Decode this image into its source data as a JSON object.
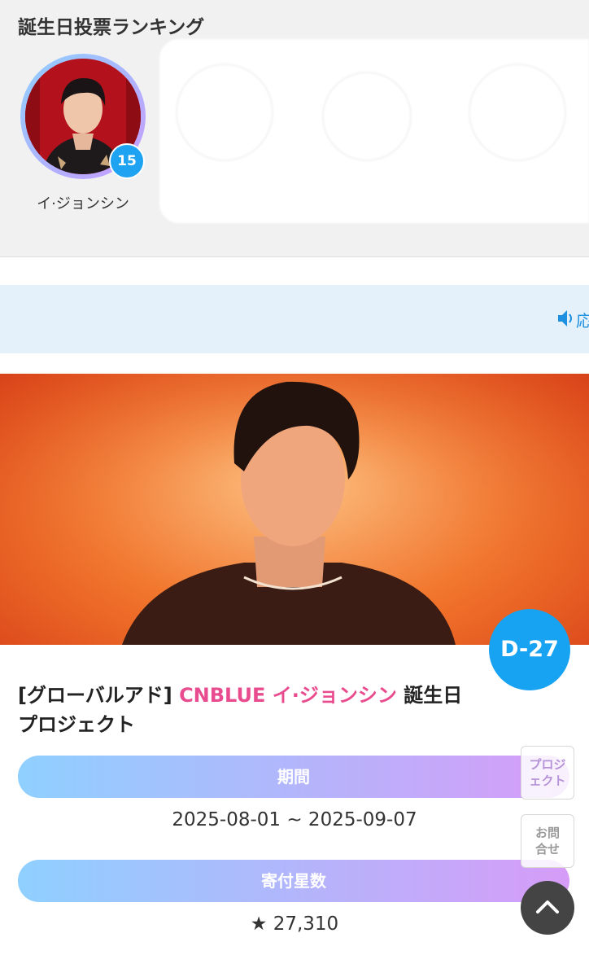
{
  "ranking": {
    "title": "誕生日投票ランキング",
    "items": [
      {
        "name": "イ·ジョンシン",
        "rank_badge": "15"
      }
    ]
  },
  "notice": {
    "text": "応"
  },
  "project": {
    "d_day": "D-27",
    "title_prefix": "[グローバルアド]",
    "title_group": "CNBLUE",
    "title_member": "イ·ジョンシン",
    "title_suffix": "誕生日プロジェクト",
    "period_label": "期間",
    "period_value": "2025-08-01 ~ 2025-09-07",
    "stars_label": "寄付星数",
    "stars_value": "★ 27,310"
  },
  "floating": {
    "project_line1": "プロジ",
    "project_line2": "ェクト",
    "contact_line1": "お問",
    "contact_line2": "合せ"
  },
  "colors": {
    "accent_blue": "#18a2f2",
    "pink": "#e94c8e",
    "notice_bg": "#e4f1fb",
    "pill_start": "#8fd0ff",
    "pill_end": "#d69cf7"
  }
}
